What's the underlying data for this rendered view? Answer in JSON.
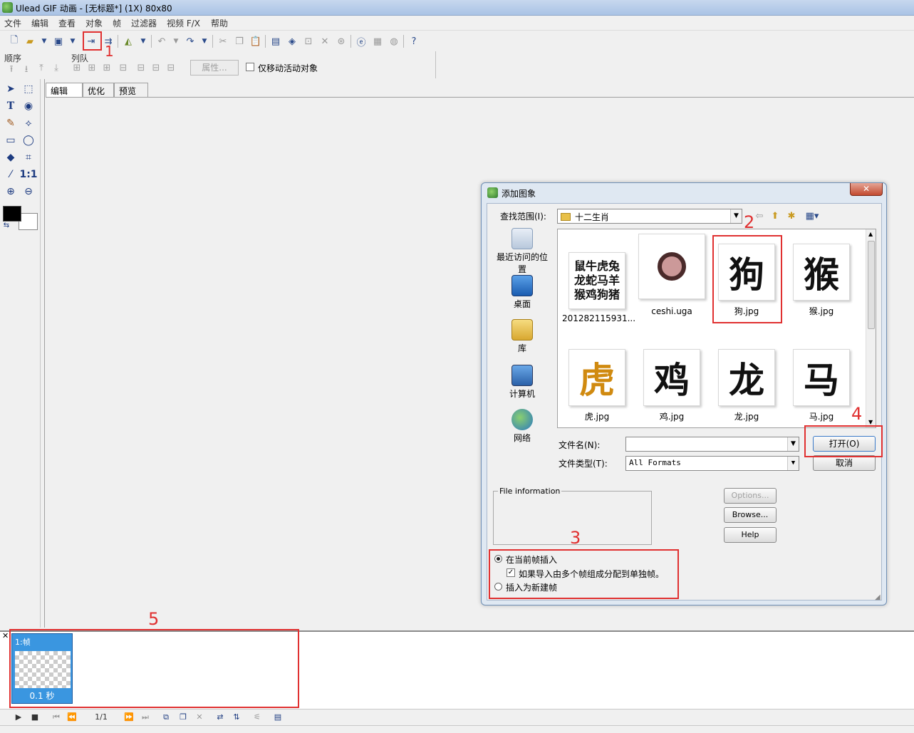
{
  "window": {
    "title": "Ulead GIF 动画 - [无标题*] (1X) 80x80"
  },
  "menubar": {
    "items": [
      "文件",
      "编辑",
      "查看",
      "对象",
      "帧",
      "过滤器",
      "视频 F/X",
      "帮助"
    ]
  },
  "objbar": {
    "order_label": "顺序",
    "align_label": "列队",
    "properties_button": "属性...",
    "move_active_only": "仅移动活动对象"
  },
  "tabs": [
    "编辑",
    "优化",
    "预览"
  ],
  "dialog": {
    "title": "添加图象",
    "close_label": "✕",
    "lookin_label": "查找范围(I):",
    "lookin_value": "十二生肖",
    "places": [
      "最近访问的位置",
      "桌面",
      "库",
      "计算机",
      "网络"
    ],
    "files": [
      {
        "name": "201282115931...",
        "thumb": "鼠牛虎兔龙蛇马羊猴鸡狗猪"
      },
      {
        "name": "ceshi.uga",
        "thumb": ""
      },
      {
        "name": "狗.jpg",
        "thumb": "狗"
      },
      {
        "name": "猴.jpg",
        "thumb": "猴"
      },
      {
        "name": "虎.jpg",
        "thumb": "虎"
      },
      {
        "name": "鸡.jpg",
        "thumb": "鸡"
      },
      {
        "name": "龙.jpg",
        "thumb": "龙"
      },
      {
        "name": "马.jpg",
        "thumb": "马"
      }
    ],
    "filename_label": "文件名(N):",
    "filename_value": "",
    "filetype_label": "文件类型(T):",
    "filetype_value": "All Formats",
    "open_button": "打开(O)",
    "cancel_button": "取消",
    "file_info_label": "File information",
    "options_button": "Options...",
    "browse_button": "Browse...",
    "help_button": "Help",
    "insert_current": "在当前帧插入",
    "split_frames": "如果导入由多个帧组成分配到单独帧。",
    "insert_new": "插入为新建帧"
  },
  "frames": [
    {
      "label": "1:帧",
      "time": "0.1 秒"
    }
  ],
  "controls": {
    "frame_counter": "1/1"
  },
  "annotations": [
    "1",
    "2",
    "3",
    "4",
    "5"
  ],
  "colors": {
    "annotation": "#e03030",
    "frame_selected": "#3a96e0"
  }
}
